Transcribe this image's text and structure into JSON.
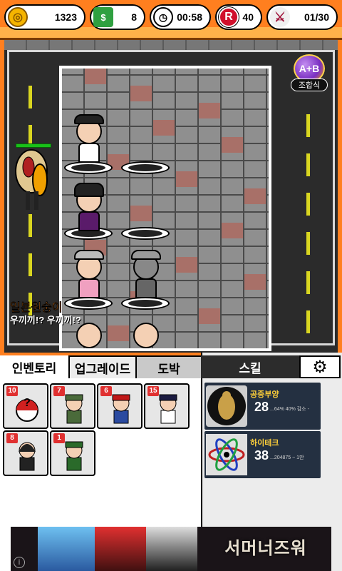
{
  "hud": {
    "gold": "1323",
    "cash": "8",
    "timer": "00:58",
    "ruby": "40",
    "wave": "01/30"
  },
  "combo": {
    "circle": "A+B",
    "label": "조합식"
  },
  "speech": {
    "name": "일본원숭이",
    "text": "우끼끼!? 우끼끼!?"
  },
  "tabs": {
    "inventory": "인벤토리",
    "upgrade": "업그레이드",
    "gamble": "도박",
    "skill": "스킬"
  },
  "inventory": [
    {
      "count": "10",
      "kind": "random"
    },
    {
      "count": "7",
      "kind": "soldier"
    },
    {
      "count": "6",
      "kind": "officer"
    },
    {
      "count": "15",
      "kind": "pilot"
    },
    {
      "count": "8",
      "kind": "girl"
    },
    {
      "count": "1",
      "kind": "general"
    }
  ],
  "skills": [
    {
      "name": "공중부양",
      "level": "28",
      "desc": "...64% 40% 감소 -"
    },
    {
      "name": "하이테크",
      "level": "38",
      "desc": "...204875 ~ 1만"
    }
  ],
  "ad": {
    "title": "서머너즈워",
    "info": "i"
  },
  "colors": {
    "accent": "#ff7f1f",
    "skill_bg": "#243041",
    "count_badge": "#e03030"
  }
}
